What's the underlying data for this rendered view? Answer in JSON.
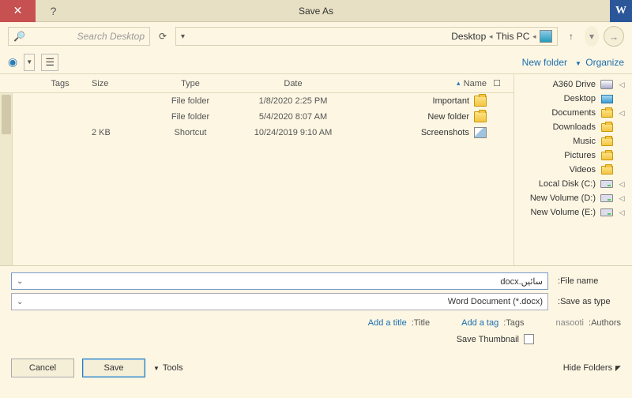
{
  "titlebar": {
    "title": "Save As",
    "app_glyph": "W"
  },
  "nav": {
    "breadcrumb": {
      "pc": "This PC",
      "loc": "Desktop"
    },
    "search_placeholder": "Search Desktop"
  },
  "toolbar": {
    "organize": "Organize",
    "new_folder": "New folder"
  },
  "sidebar": {
    "items": [
      {
        "label": "A360 Drive",
        "icon": "drive",
        "expandable": true
      },
      {
        "label": "Desktop",
        "icon": "desktop",
        "expandable": false
      },
      {
        "label": "Documents",
        "icon": "folder",
        "expandable": true
      },
      {
        "label": "Downloads",
        "icon": "folder",
        "expandable": false
      },
      {
        "label": "Music",
        "icon": "folder",
        "expandable": false
      },
      {
        "label": "Pictures",
        "icon": "folder",
        "expandable": false
      },
      {
        "label": "Videos",
        "icon": "folder",
        "expandable": false
      },
      {
        "label": "Local Disk (C:)",
        "icon": "disk",
        "expandable": true
      },
      {
        "label": "New Volume (D:)",
        "icon": "disk",
        "expandable": true
      },
      {
        "label": "New Volume (E:)",
        "icon": "disk",
        "expandable": true
      }
    ]
  },
  "columns": {
    "name": "Name",
    "date": "Date",
    "type": "Type",
    "size": "Size",
    "tags": "Tags"
  },
  "files": [
    {
      "name": "Important",
      "date": "1/8/2020 2:25 PM",
      "type": "File folder",
      "size": "",
      "icon": "folder"
    },
    {
      "name": "New folder",
      "date": "5/4/2020 8:07 AM",
      "type": "File folder",
      "size": "",
      "icon": "folder"
    },
    {
      "name": "Screenshots",
      "date": "10/24/2019 9:10 AM",
      "type": "Shortcut",
      "size": "2 KB",
      "icon": "shortcut"
    }
  ],
  "form": {
    "filename_label": "File name:",
    "filename_value": "سائیں.docx",
    "savetype_label": "Save as type:",
    "savetype_value": "Word Document (*.docx)"
  },
  "meta": {
    "authors_label": "Authors:",
    "authors_value": "nasooti",
    "tags_label": "Tags:",
    "tags_value": "Add a tag",
    "title_label": "Title:",
    "title_value": "Add a title",
    "save_thumbnail": "Save Thumbnail"
  },
  "footer": {
    "hide_folders": "Hide Folders",
    "tools": "Tools",
    "save": "Save",
    "cancel": "Cancel"
  }
}
